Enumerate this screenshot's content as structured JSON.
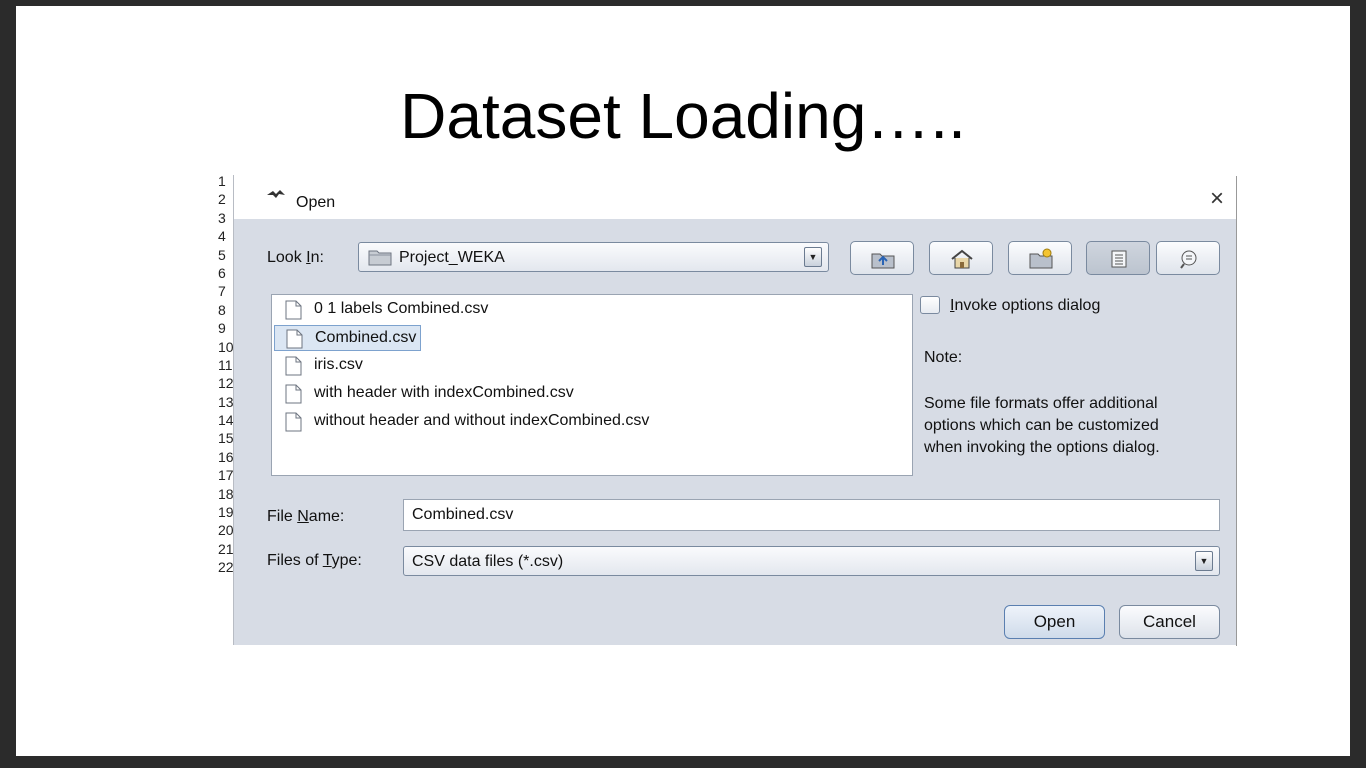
{
  "slide": {
    "title": "Dataset Loading….."
  },
  "background_sheet": {
    "row_numbers": [
      "1",
      "2",
      "3",
      "4",
      "5",
      "6",
      "7",
      "8",
      "9",
      "10",
      "11",
      "12",
      "13",
      "14",
      "15",
      "16",
      "17",
      "18",
      "19",
      "20",
      "21",
      "22"
    ]
  },
  "dialog": {
    "title": "Open",
    "close_label": "×",
    "look_in": {
      "label_pre": "Look ",
      "label_mn": "I",
      "label_post": "n:",
      "value": "Project_WEKA"
    },
    "toolbar_buttons": [
      "up-one-level",
      "home",
      "create-new-folder",
      "list-view",
      "details-view"
    ],
    "files": [
      "0 1 labels Combined.csv",
      "Combined.csv",
      "iris.csv",
      "with header with indexCombined.csv",
      "without header and without indexCombined.csv"
    ],
    "selected_file_index": 1,
    "invoke_options": {
      "mn": "I",
      "rest": "nvoke options dialog",
      "checked": false
    },
    "note_title": "Note:",
    "note_lines": [
      "Some file formats offer additional",
      "options which can be customized",
      "when invoking the options dialog."
    ],
    "file_name": {
      "label_pre": "File ",
      "label_mn": "N",
      "label_post": "ame:",
      "value": "Combined.csv"
    },
    "file_type": {
      "label_pre": "Files of ",
      "label_mn": "T",
      "label_post": "ype:",
      "value": "CSV data files (*.csv)"
    },
    "open_label": "Open",
    "cancel_label": "Cancel"
  }
}
